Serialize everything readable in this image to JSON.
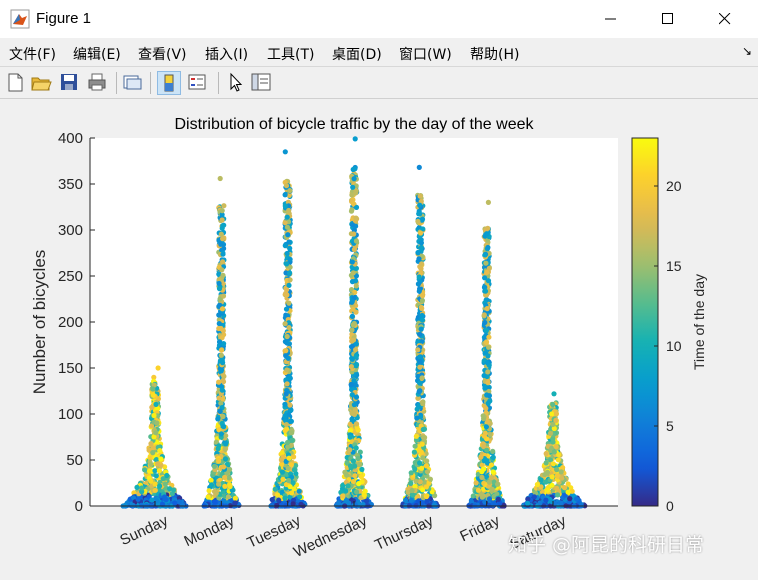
{
  "window": {
    "title": "Figure 1",
    "controls": [
      "minimize",
      "maximize",
      "close"
    ]
  },
  "menu": [
    "文件(F)",
    "编辑(E)",
    "查看(V)",
    "插入(I)",
    "工具(T)",
    "桌面(D)",
    "窗口(W)",
    "帮助(H)"
  ],
  "toolbar": {
    "icons": [
      "new-figure-icon",
      "open-file-icon",
      "save-icon",
      "print-icon",
      "link-plot-icon",
      "insert-colorbar-icon",
      "insert-legend-icon",
      "pointer-icon",
      "property-inspector-icon"
    ],
    "active": "insert-colorbar-icon"
  },
  "watermark": "知乎 @阿昆的科研日常",
  "chart_data": {
    "type": "scatter",
    "title": "Distribution of bicycle traffic by the day of the week",
    "xlabel": "",
    "ylabel": "Number of bicycles",
    "categories": [
      "Sunday",
      "Monday",
      "Tuesday",
      "Wednesday",
      "Thursday",
      "Friday",
      "Saturday"
    ],
    "ylim": [
      0,
      400
    ],
    "yticks": [
      0,
      50,
      100,
      150,
      200,
      250,
      300,
      350,
      400
    ],
    "max_values": [
      150,
      356,
      385,
      399,
      368,
      330,
      122
    ],
    "colorbar": {
      "label": "Time of the day",
      "range": [
        0,
        23
      ],
      "ticks": [
        0,
        5,
        10,
        15,
        20
      ],
      "colormap": "parula"
    },
    "grid": false
  }
}
